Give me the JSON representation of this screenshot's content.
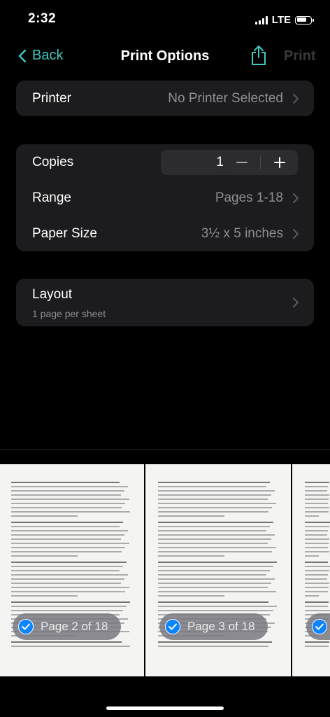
{
  "status_bar": {
    "time": "2:32",
    "network": "LTE"
  },
  "nav": {
    "back_label": "Back",
    "title": "Print Options",
    "share_icon": "share-icon",
    "print_label": "Print"
  },
  "printer": {
    "label": "Printer",
    "value": "No Printer Selected"
  },
  "copies": {
    "label": "Copies",
    "value": "1",
    "minus": "−",
    "plus": "+"
  },
  "range": {
    "label": "Range",
    "value": "Pages 1-18"
  },
  "paper_size": {
    "label": "Paper Size",
    "value": "3½ x 5 inches"
  },
  "layout": {
    "label": "Layout",
    "subtitle": "1 page per sheet"
  },
  "previews": [
    {
      "badge": "Page 2 of 18",
      "selected": true
    },
    {
      "badge": "Page 3 of 18",
      "selected": true
    },
    {
      "badge": "",
      "selected": true
    }
  ],
  "colors": {
    "accent": "#40c8c0",
    "group_bg": "#1c1c1e",
    "secondary_text": "#8e8e93",
    "check": "#0a84ff"
  }
}
